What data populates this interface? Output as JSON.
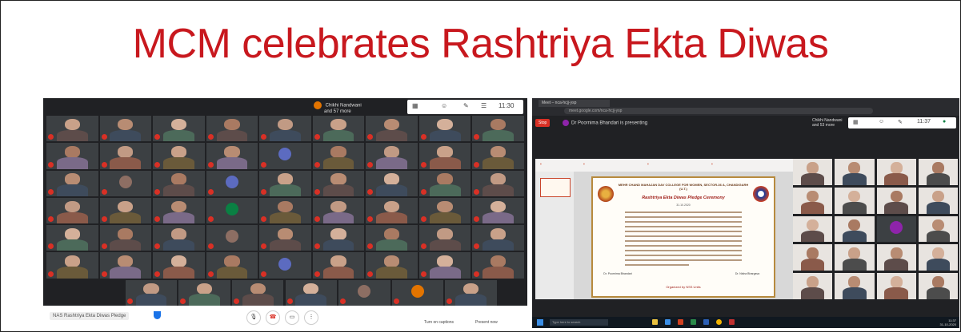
{
  "slide": {
    "title": "MCM celebrates Rashtriya Ekta Diwas"
  },
  "left_meet": {
    "presenter_chip": "Chikhi Nandwani",
    "presenter_sub": "and 57 more",
    "time": "11:30",
    "meeting_name": "NAS Rashtriya Ekta Diwas Pledge",
    "caption_label": "Turn on captions",
    "present_label": "Present now",
    "tile_count": 60
  },
  "right_meet": {
    "browser_tab": "Meet – nca-hcjj-ysp",
    "url": "meet.google.com/nca-hcjj-ysp",
    "stop_label": "Stop",
    "presenting_text": "Dr Poornima Bhandari is presenting",
    "chip_name": "Chikhi Nandwani",
    "chip_sub": "and 53 more",
    "time": "11:37",
    "certificate": {
      "institute": "MEHR CHAND MAHAJAN DAV COLLEGE FOR WOMEN, SECTOR-36 A, CHANDIGARH (U.T.)",
      "heading": "Rashtriya Ekta Diwas Pledge Ceremony",
      "date_line": "31.10.2020",
      "sig_left": "Dr. Poornima Bhandari",
      "sig_right": "Dr. Nisha Bhargava",
      "organizer": "Organized by NSS Units"
    },
    "taskbar_search": "Type here to search",
    "clock_time": "11:37",
    "clock_date": "31-10-2020"
  },
  "colors": {
    "title_red": "#c8181e",
    "meet_dark": "#202124",
    "tile_gray": "#3c4043",
    "mic_red": "#d93025"
  }
}
